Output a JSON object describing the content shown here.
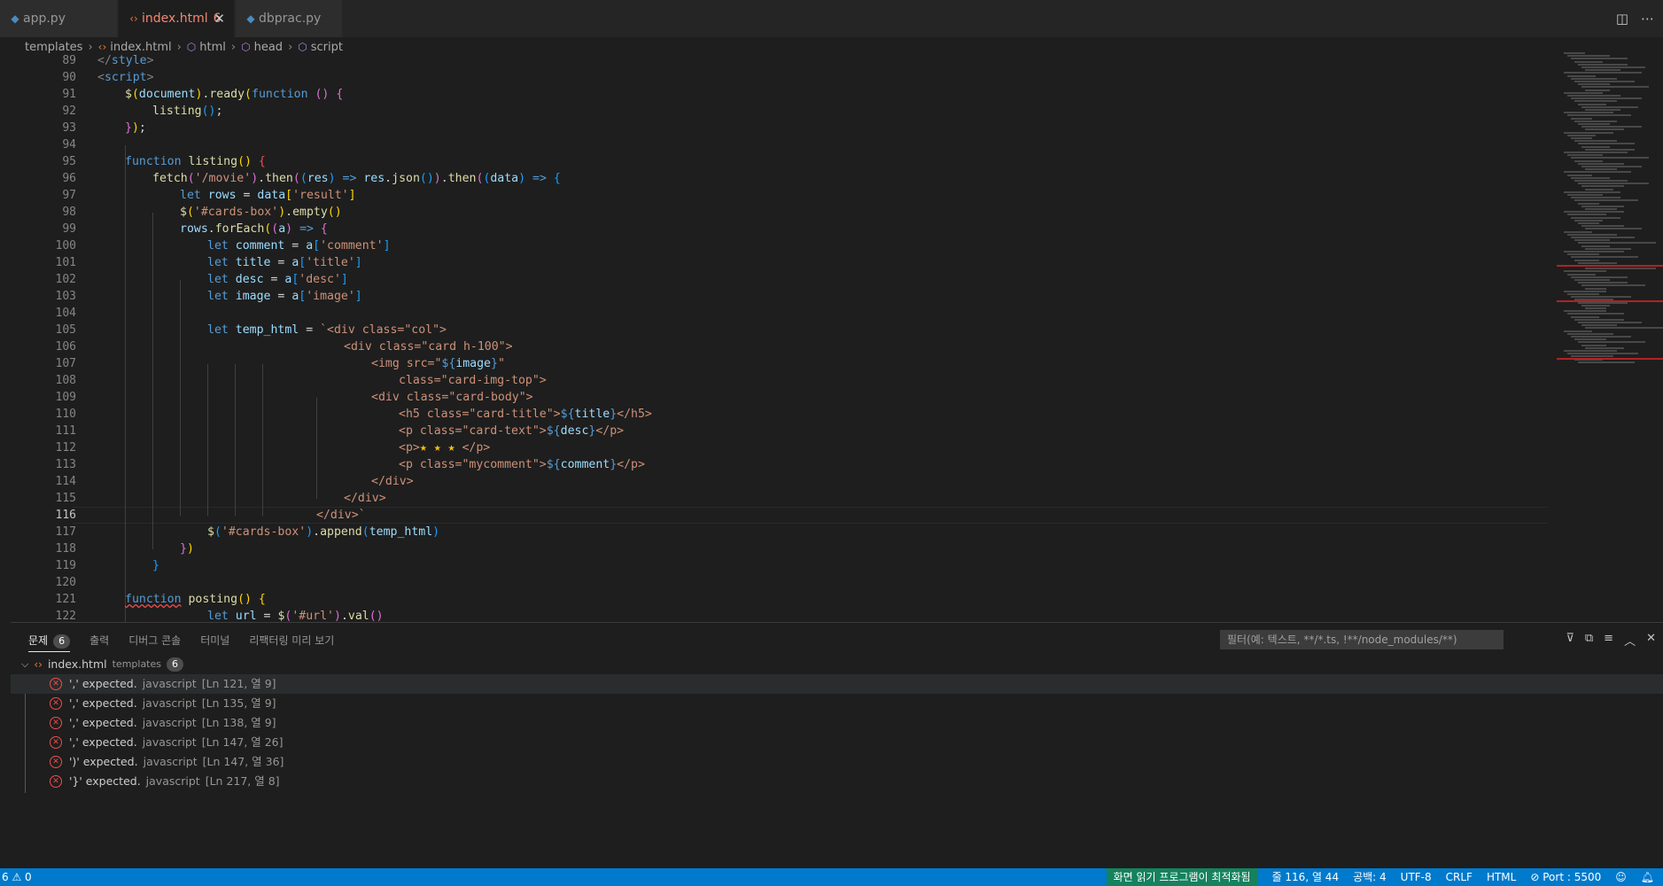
{
  "tabs": [
    {
      "label": "app.py",
      "icon": "python-icon",
      "active": false
    },
    {
      "label": "index.html",
      "icon": "html-icon",
      "active": true,
      "problems": "6"
    },
    {
      "label": "dbprac.py",
      "icon": "python-icon",
      "active": false
    }
  ],
  "breadcrumb": [
    "templates",
    "index.html",
    "html",
    "head",
    "script"
  ],
  "editor": {
    "line_numbers": [
      "89",
      "90",
      "91",
      "92",
      "93",
      "94",
      "95",
      "96",
      "97",
      "98",
      "99",
      "100",
      "101",
      "102",
      "103",
      "104",
      "105",
      "106",
      "107",
      "108",
      "109",
      "110",
      "111",
      "112",
      "113",
      "114",
      "115",
      "116",
      "117",
      "118",
      "119",
      "120",
      "121",
      "122"
    ],
    "current_line": "116"
  },
  "panel": {
    "tabs": [
      {
        "label": "문제",
        "badge": "6"
      },
      {
        "label": "출력"
      },
      {
        "label": "디버그 콘솔"
      },
      {
        "label": "터미널"
      },
      {
        "label": "리팩터링 미리 보기"
      }
    ],
    "filter_placeholder": "필터(예: 텍스트, **/*.ts, !**/node_modules/**)",
    "group": {
      "file": "index.html",
      "folder": "templates",
      "count": "6"
    },
    "problems": [
      {
        "message": "',' expected.",
        "source": "javascript",
        "location": "[Ln 121, 열 9]"
      },
      {
        "message": "',' expected.",
        "source": "javascript",
        "location": "[Ln 135, 열 9]"
      },
      {
        "message": "',' expected.",
        "source": "javascript",
        "location": "[Ln 138, 열 9]"
      },
      {
        "message": "',' expected.",
        "source": "javascript",
        "location": "[Ln 147, 열 26]"
      },
      {
        "message": "')' expected.",
        "source": "javascript",
        "location": "[Ln 147, 열 36]"
      },
      {
        "message": "'}' expected.",
        "source": "javascript",
        "location": "[Ln 217, 열 8]"
      }
    ]
  },
  "status": {
    "problems": "6 ⚠ 0",
    "screen_reader": "화면 읽기 프로그램이 최적화됨",
    "position": "줄 116, 열 44",
    "spaces": "공백: 4",
    "encoding": "UTF-8",
    "eol": "CRLF",
    "language": "HTML",
    "port": "Port : 5500"
  },
  "colors": {
    "accent": "#007acc",
    "error": "#f14c4c",
    "editor_bg": "#1e1e1e"
  }
}
